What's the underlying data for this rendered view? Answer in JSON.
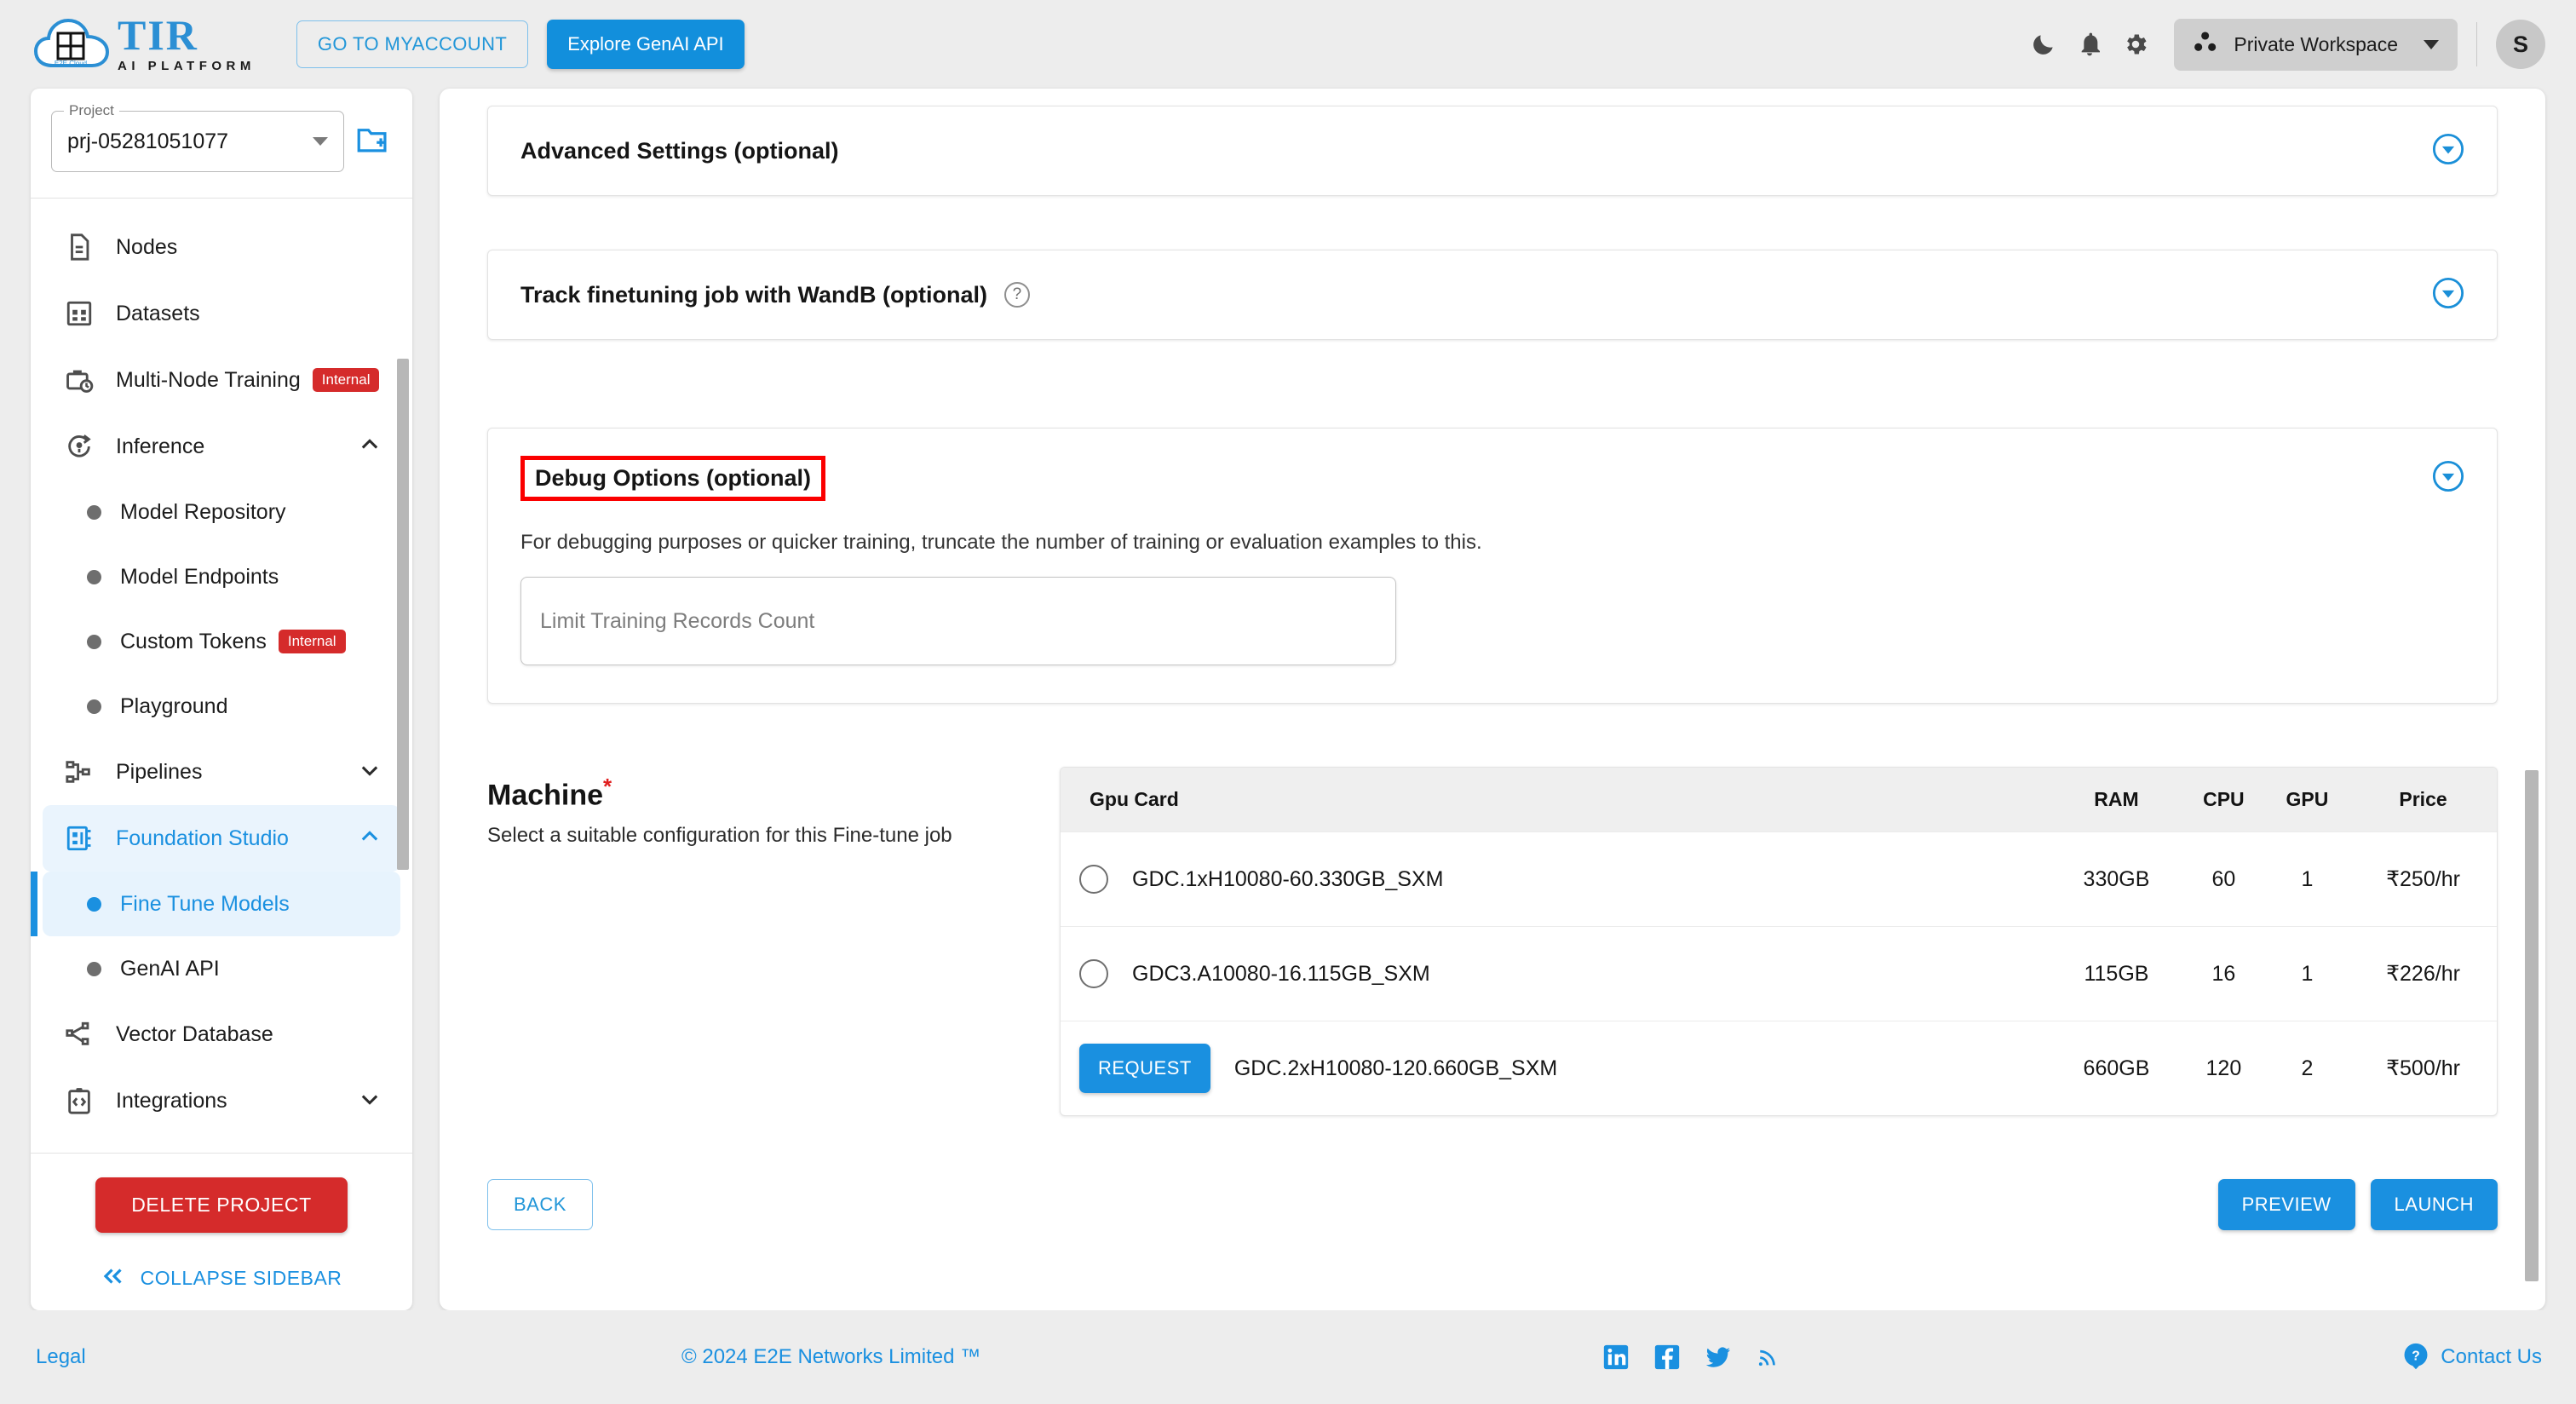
{
  "header": {
    "logo_title": "TIR",
    "logo_subtitle": "AI PLATFORM",
    "logo_badge": "E2E Cloud",
    "myaccount_label": "GO TO MYACCOUNT",
    "genai_label": "Explore GenAI API",
    "workspace_label": "Private Workspace",
    "avatar_initial": "S",
    "icons": [
      "dark-mode-icon",
      "notifications-icon",
      "settings-icon"
    ]
  },
  "sidebar": {
    "project_legend": "Project",
    "project_value": "prj-05281051077",
    "new_project_icon": "new-folder-icon",
    "items": [
      {
        "label": "Nodes",
        "icon": "document-icon",
        "badge": null,
        "expandable": false
      },
      {
        "label": "Datasets",
        "icon": "grid-icon",
        "badge": null,
        "expandable": false
      },
      {
        "label": "Multi-Node Training",
        "icon": "briefcase-clock-icon",
        "badge": "Internal",
        "expandable": false
      },
      {
        "label": "Inference",
        "icon": "inference-icon",
        "badge": null,
        "expandable": true,
        "expanded": true
      },
      {
        "label": "Pipelines",
        "icon": "pipeline-icon",
        "badge": null,
        "expandable": true,
        "expanded": false
      },
      {
        "label": "Foundation Studio",
        "icon": "foundation-icon",
        "badge": null,
        "expandable": true,
        "expanded": true,
        "active": true
      },
      {
        "label": "Vector Database",
        "icon": "vector-icon",
        "badge": null,
        "expandable": false
      },
      {
        "label": "Integrations",
        "icon": "integrations-icon",
        "badge": null,
        "expandable": true,
        "expanded": false
      }
    ],
    "inference_children": [
      {
        "label": "Model Repository",
        "badge": null
      },
      {
        "label": "Model Endpoints",
        "badge": null
      },
      {
        "label": "Custom Tokens",
        "badge": "Internal"
      },
      {
        "label": "Playground",
        "badge": null
      }
    ],
    "foundation_children": [
      {
        "label": "Fine Tune Models",
        "selected": true
      },
      {
        "label": "GenAI API",
        "selected": false
      }
    ],
    "delete_project_label": "DELETE PROJECT",
    "collapse_label": "COLLAPSE SIDEBAR"
  },
  "main": {
    "advanced_settings": {
      "title": "Advanced Settings (optional)"
    },
    "wandb": {
      "title": "Track finetuning job with WandB (optional)",
      "help": "?"
    },
    "debug": {
      "title": "Debug Options (optional)",
      "description": "For debugging purposes or quicker training, truncate the number of training or evaluation examples to this.",
      "input_placeholder": "Limit Training Records Count",
      "input_value": ""
    },
    "machine": {
      "title": "Machine",
      "required_marker": "*",
      "subtitle": "Select a suitable configuration for this Fine-tune job",
      "columns": [
        "Gpu Card",
        "RAM",
        "CPU",
        "GPU",
        "Price"
      ],
      "rows": [
        {
          "control": "radio",
          "name": "GDC.1xH10080-60.330GB_SXM",
          "ram": "330GB",
          "cpu": "60",
          "gpu": "1",
          "price": "₹250/hr"
        },
        {
          "control": "radio",
          "name": "GDC3.A10080-16.115GB_SXM",
          "ram": "115GB",
          "cpu": "16",
          "gpu": "1",
          "price": "₹226/hr"
        },
        {
          "control": "request",
          "control_label": "REQUEST",
          "name": "GDC.2xH10080-120.660GB_SXM",
          "ram": "660GB",
          "cpu": "120",
          "gpu": "2",
          "price": "₹500/hr"
        }
      ]
    },
    "actions": {
      "back": "BACK",
      "preview": "PREVIEW",
      "launch": "LAUNCH"
    }
  },
  "footer": {
    "legal": "Legal",
    "copyright": "© 2024 E2E Networks Limited ™",
    "social": [
      "linkedin-icon",
      "facebook-icon",
      "twitter-icon",
      "rss-icon"
    ],
    "contact": "Contact Us"
  },
  "colors": {
    "accent": "#1a90e0",
    "danger": "#d52b2b",
    "highlight": "#fb0000",
    "page_bg": "#ededed"
  }
}
